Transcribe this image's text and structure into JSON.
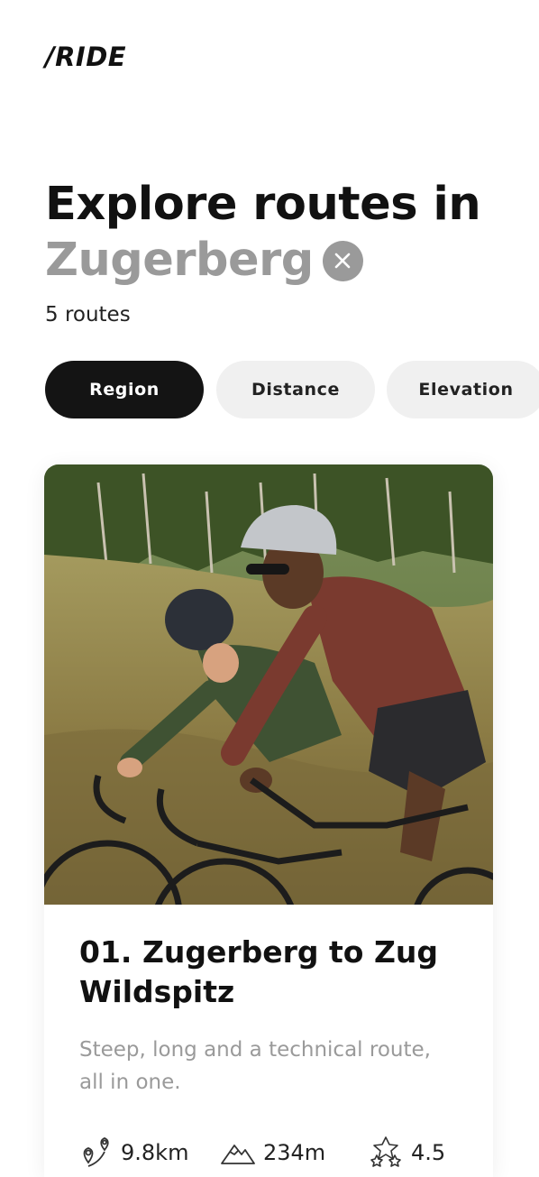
{
  "brand": {
    "logo_text": "/RIDE"
  },
  "header": {
    "title_line1": "Explore routes in",
    "location": "Zugerberg",
    "route_count": "5 routes"
  },
  "filters": [
    {
      "label": "Region",
      "active": true
    },
    {
      "label": "Distance",
      "active": false
    },
    {
      "label": "Elevation",
      "active": false
    }
  ],
  "route_card": {
    "title": "01. Zugerberg to Zug Wildspitz",
    "description": "Steep, long and a technical route, all in one.",
    "stats": {
      "distance": "9.8km",
      "elevation": "234m",
      "rating": "4.5"
    },
    "icons": {
      "distance": "route-pin-icon",
      "elevation": "mountain-icon",
      "rating": "stars-icon"
    }
  },
  "colors": {
    "text_primary": "#111111",
    "text_muted": "#9a9a9a",
    "chip_active_bg": "#141414",
    "chip_bg": "#f0f0f0"
  }
}
